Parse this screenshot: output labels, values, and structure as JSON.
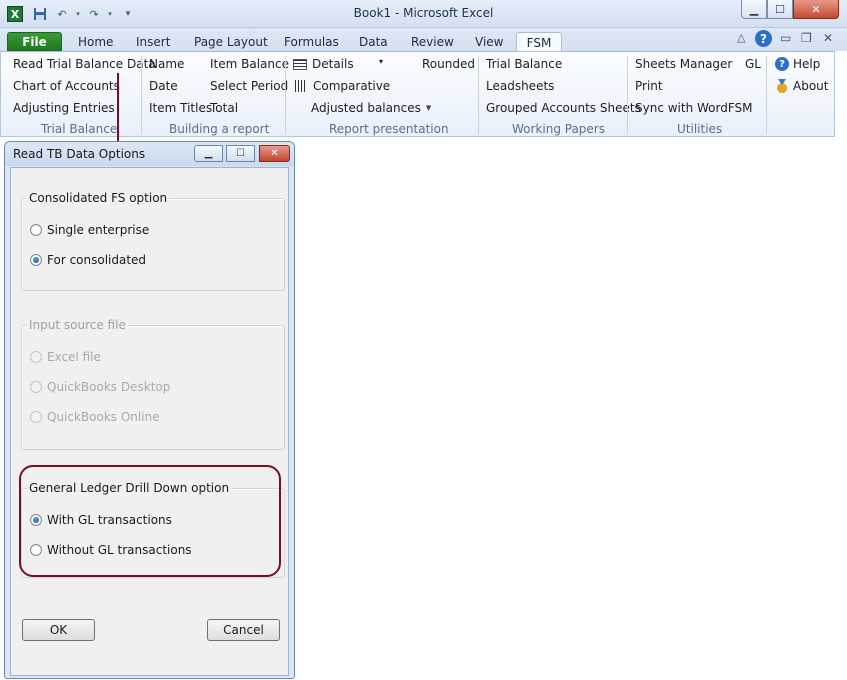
{
  "titlebar": {
    "title": "Book1  -  Microsoft Excel",
    "app_icon": "excel-icon",
    "qat": [
      "save-icon",
      "undo-icon",
      "redo-icon",
      "customize-qat-icon"
    ],
    "app_icon_letter": "X"
  },
  "tabs": {
    "file": "File",
    "home": "Home",
    "insert": "Insert",
    "page_layout": "Page Layout",
    "formulas": "Formulas",
    "data": "Data",
    "review": "Review",
    "view": "View",
    "fsm": "FSM"
  },
  "ribbon": {
    "trial_balance": {
      "items": [
        "Read Trial Balance Data",
        "Chart of Accounts",
        "Adjusting Entries"
      ],
      "label": "Trial Balance"
    },
    "building_report": {
      "items": [
        "Name",
        "Item Balance",
        "Date",
        "Select Period",
        "Item Titles",
        "Total"
      ],
      "label": "Building a report"
    },
    "report_presentation": {
      "details": "Details",
      "rounded": "Rounded",
      "comparative": "Comparative",
      "adjusted_balances": "Adjusted balances",
      "label": "Report presentation"
    },
    "working_papers": {
      "items": [
        "Trial Balance",
        "Leadsheets",
        "Grouped Accounts Sheets"
      ],
      "label": "Working Papers"
    },
    "utilities": {
      "items": [
        "Sheets Manager",
        "GL",
        "Print",
        "Sync with WordFSM"
      ],
      "label": "Utilities"
    },
    "help": {
      "help": "Help",
      "about": "About"
    }
  },
  "dialog": {
    "title": "Read TB Data Options",
    "consolidated": {
      "legend": "Consolidated FS option",
      "options": [
        "Single enterprise",
        "For consolidated"
      ],
      "selected": "For consolidated"
    },
    "input_source": {
      "legend": "Input source file",
      "options": [
        "Excel file",
        "QuickBooks Desktop",
        "QuickBooks Online"
      ],
      "enabled": false
    },
    "gl_drill": {
      "legend": "General Ledger Drill Down option",
      "options": [
        "With GL transactions",
        "Without GL transactions"
      ],
      "selected": "With GL transactions"
    },
    "ok": "OK",
    "cancel": "Cancel"
  },
  "colors": {
    "highlight": "#7a0f23",
    "file_tab": "#2a8a2a"
  }
}
